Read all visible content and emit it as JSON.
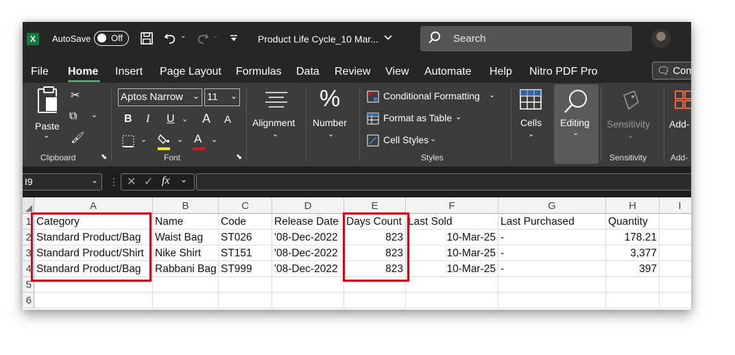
{
  "titlebar": {
    "logo": "X",
    "autosave_label": "AutoSave",
    "autosave_state": "Off",
    "doc_title": "Product Life Cycle_10 Mar...",
    "search_placeholder": "Search"
  },
  "menu": {
    "tabs": [
      "File",
      "Home",
      "Insert",
      "Page Layout",
      "Formulas",
      "Data",
      "Review",
      "View",
      "Automate",
      "Help",
      "Nitro PDF Pro"
    ],
    "active": "Home",
    "comments_label": "Com"
  },
  "ribbon": {
    "clipboard": {
      "paste_label": "Paste",
      "group_label": "Clipboard"
    },
    "font": {
      "font_name": "Aptos Narrow",
      "font_size": "11",
      "group_label": "Font",
      "bold": "B",
      "italic": "I",
      "underline": "U",
      "grow": "A",
      "shrink": "A",
      "color_glyph": "A"
    },
    "alignment": {
      "label": "Alignment"
    },
    "number": {
      "label": "Number",
      "icon_glyph": "%"
    },
    "styles": {
      "conditional": "Conditional Formatting",
      "format_table": "Format as Table",
      "cell_styles": "Cell Styles",
      "group_label": "Styles"
    },
    "cells": {
      "label": "Cells"
    },
    "editing": {
      "label": "Editing"
    },
    "sensitivity": {
      "label": "Sensitivity",
      "group_label": "Sensitivity"
    },
    "addins": {
      "label": "Add-",
      "group_label": "Add-"
    }
  },
  "formula_bar": {
    "name_box": "I9",
    "fx": "fx",
    "value": ""
  },
  "sheet": {
    "columns": [
      "A",
      "B",
      "C",
      "D",
      "E",
      "F",
      "G",
      "H",
      "I"
    ],
    "rows": [
      "1",
      "2",
      "3",
      "4",
      "5",
      "6"
    ],
    "headers": [
      "Category",
      "Name",
      "Code",
      "Release Date",
      "Days Count",
      "Last Sold",
      "Last Purchased",
      "Quantity"
    ],
    "data": [
      [
        "Standard Product/Bag",
        "Waist Bag",
        "ST026",
        "'08-Dec-2022",
        "823",
        "10-Mar-25",
        "-",
        "178.21"
      ],
      [
        "Standard Product/Shirt",
        "Nike Shirt",
        "ST151",
        "'08-Dec-2022",
        "823",
        "10-Mar-25",
        "-",
        "3,377"
      ],
      [
        "Standard Product/Bag",
        "Rabbani Bag",
        "ST999",
        "'08-Dec-2022",
        "823",
        "10-Mar-25",
        "-",
        "397"
      ]
    ]
  },
  "colors": {
    "excel_green": "#107c41",
    "highlight_red": "#e3000f",
    "ribbon_bg": "#3c3c3c",
    "title_bg": "#262626"
  }
}
